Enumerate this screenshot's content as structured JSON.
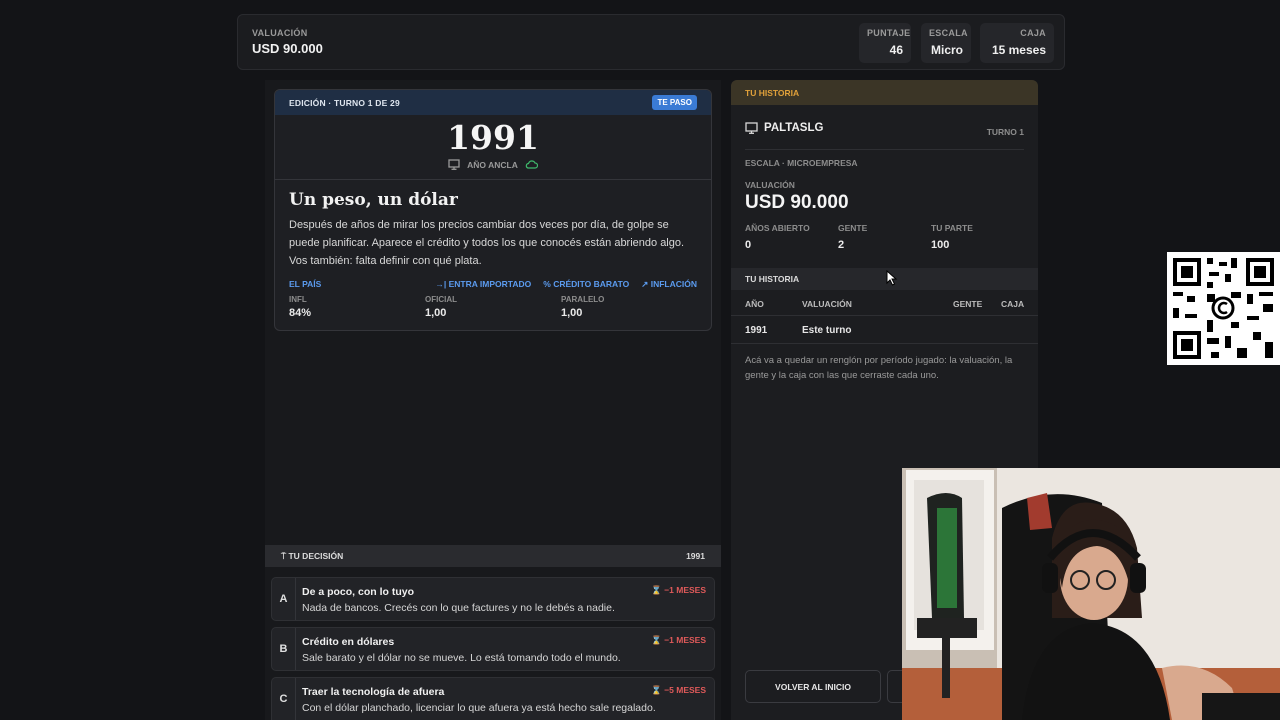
{
  "topbar": {
    "valuation_label": "VALUACIÓN",
    "valuation_value": "USD 90.000",
    "stats": [
      {
        "label": "PUNTAJE",
        "value": "46"
      },
      {
        "label": "ESCALA",
        "value": "Micro"
      },
      {
        "label": "CAJA",
        "value": "15 meses"
      }
    ]
  },
  "edition": {
    "header": "EDICIÓN · TURNO 1 DE 29",
    "badge": "TE PASO",
    "year": "1991",
    "anchor_label": "AÑO ANCLA",
    "title": "Un peso, un dólar",
    "body": "Después de años de mirar los precios cambiar dos veces por día, de golpe se puede planificar. Aparece el crédito y todos los que conocés están abriendo algo. Vos también: falta definir con qué plata.",
    "country_label": "EL PAÍS",
    "tags": [
      "ENTRA IMPORTADO",
      "CRÉDITO BARATO",
      "INFLACIÓN"
    ],
    "indicators": [
      {
        "label": "INFL",
        "value": "84%"
      },
      {
        "label": "OFICIAL",
        "value": "1,00"
      },
      {
        "label": "PARALELO",
        "value": "1,00"
      }
    ]
  },
  "decision": {
    "header": "TU DECISIÓN",
    "year": "1991",
    "options": [
      {
        "letter": "A",
        "title": "De a poco, con lo tuyo",
        "desc": "Nada de bancos. Crecés con lo que factures y no le debés a nadie.",
        "cost": "−1 MESES"
      },
      {
        "letter": "B",
        "title": "Crédito en dólares",
        "desc": "Sale barato y el dólar no se mueve. Lo está tomando todo el mundo.",
        "cost": "−1 MESES"
      },
      {
        "letter": "C",
        "title": "Traer la tecnología de afuera",
        "desc": "Con el dólar planchado, licenciar lo que afuera ya está hecho sale regalado.",
        "cost": "−5 MESES"
      }
    ]
  },
  "history_panel": {
    "header": "TU HISTORIA",
    "user": "PALTASLG",
    "turn": "TURNO 1",
    "scale": "ESCALA · MICROEMPRESA",
    "valuation_label": "VALUACIÓN",
    "valuation_value": "USD 90.000",
    "stats": [
      {
        "label": "AÑOS ABIERTO",
        "value": "0"
      },
      {
        "label": "GENTE",
        "value": "2"
      },
      {
        "label": "TU PARTE",
        "value": "100"
      }
    ],
    "table_title": "TU HISTORIA",
    "columns": {
      "year": "AÑO",
      "valuation": "VALUACIÓN",
      "people": "GENTE",
      "cash": "CAJA"
    },
    "rows": [
      {
        "year": "1991",
        "valuation": "Este turno",
        "people": "",
        "cash": ""
      }
    ],
    "note": "Acá va a quedar un renglón por período jugado: la valuación, la gente y la caja con las que cerraste cada uno.",
    "back_button": "VOLVER AL INICIO"
  },
  "colors": {
    "accent_blue": "#5b9bef",
    "accent_orange": "#e1a13a",
    "cost_red": "#e05a5a",
    "badge_blue": "#3a7bd5"
  },
  "icons": [
    "monitor-icon",
    "cloud-icon",
    "arrow-import-icon",
    "percent-icon",
    "trend-up-icon",
    "hourglass-icon",
    "pin-icon",
    "cursor-icon",
    "qr-code"
  ]
}
